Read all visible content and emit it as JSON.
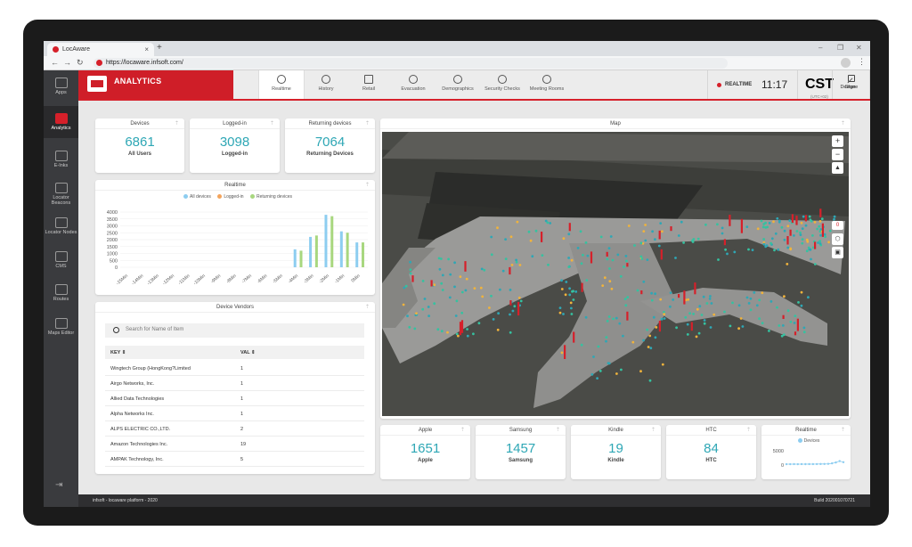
{
  "browser": {
    "tab_title": "LocAware",
    "url": "https://locaware.infsoft.com/"
  },
  "sidebar": {
    "items": [
      {
        "label": "Apps"
      },
      {
        "label": "Analytics"
      },
      {
        "label": "E-Inks"
      },
      {
        "label": "Locator Beacons"
      },
      {
        "label": "Locator Nodes"
      },
      {
        "label": "CMS"
      },
      {
        "label": "Routes"
      },
      {
        "label": "Maps Editor"
      }
    ]
  },
  "header": {
    "brand": "ANALYTICS",
    "tabs": [
      {
        "label": "Realtime"
      },
      {
        "label": "History"
      },
      {
        "label": "Retail"
      },
      {
        "label": "Evacuation"
      },
      {
        "label": "Demographics"
      },
      {
        "label": "Security Checks"
      },
      {
        "label": "Meeting Rooms"
      }
    ],
    "realtime_label": "REALTIME",
    "time": "11:17",
    "timezone": "CST",
    "timezone_offset": "(UTC+02)",
    "design_label": "Design",
    "share_label": "Share"
  },
  "kpis": {
    "devices": {
      "title": "Devices",
      "value": "6861",
      "label": "All Users"
    },
    "logged_in": {
      "title": "Logged-in",
      "value": "3098",
      "label": "Logged-in"
    },
    "returning": {
      "title": "Returning devices",
      "value": "7064",
      "label": "Returning Devices"
    }
  },
  "realtime": {
    "title": "Realtime",
    "legend": [
      "All devices",
      "Logged-in",
      "Returning devices"
    ]
  },
  "vendors": {
    "title": "Device Vendors",
    "search_placeholder": "Search for Name of Item",
    "col_key": "KEY",
    "col_val": "VAL",
    "rows": [
      {
        "key": "Wingtech Group (HongKong?Limited",
        "val": "1"
      },
      {
        "key": "Airgo Networks, Inc.",
        "val": "1"
      },
      {
        "key": "Allied Data Technologies",
        "val": "1"
      },
      {
        "key": "Alpha Networks Inc.",
        "val": "1"
      },
      {
        "key": "ALPS ELECTRIC CO.,LTD.",
        "val": "2"
      },
      {
        "key": "Amazon Technologies Inc.",
        "val": "19"
      },
      {
        "key": "AMPAK Technology, Inc.",
        "val": "5"
      }
    ]
  },
  "map": {
    "title": "Map"
  },
  "brands": {
    "apple": {
      "title": "Apple",
      "value": "1651",
      "label": "Apple"
    },
    "samsung": {
      "title": "Samsung",
      "value": "1457",
      "label": "Samsung"
    },
    "kindle": {
      "title": "Kindle",
      "value": "19",
      "label": "Kindle"
    },
    "htc": {
      "title": "HTC",
      "value": "84",
      "label": "HTC"
    }
  },
  "mini_realtime": {
    "title": "Realtime",
    "legend": "Devices",
    "ytick": "5000",
    "ytick0": "0"
  },
  "footer": {
    "left": "infsoft - locaware platform - 2020",
    "right": "Build 202001070721"
  },
  "colors": {
    "accent": "#d6202a",
    "kpi": "#2ea7b5",
    "all_devices": "#8dcdf0",
    "logged_in": "#f3a45c",
    "returning": "#a8d77f"
  },
  "chart_data": [
    {
      "type": "bar",
      "title": "Realtime",
      "categories": [
        "-15Min",
        "-14Min",
        "-13Min",
        "-12Min",
        "-11Min",
        "-10Min",
        "-9Min",
        "-8Min",
        "-7Min",
        "-6Min",
        "-5Min",
        "-4Min",
        "-3Min",
        "-2Min",
        "-1Min",
        "0Min"
      ],
      "x_tick_labels": [
        "-15Min",
        "-14Min",
        "-13Min",
        "-12Min",
        "-11Min",
        "-10Min",
        "-9Min",
        "-8Min",
        "-7Min",
        "-6Min",
        "-5Min",
        "-4Min",
        "-3Min",
        "-2Min",
        "-1Min",
        "0Min"
      ],
      "series": [
        {
          "name": "All devices",
          "values": [
            0,
            0,
            0,
            0,
            0,
            0,
            0,
            0,
            0,
            0,
            0,
            1300,
            2200,
            3800,
            2600,
            1800
          ]
        },
        {
          "name": "Logged-in",
          "values": [
            0,
            0,
            0,
            0,
            0,
            0,
            0,
            0,
            0,
            0,
            0,
            0,
            0,
            0,
            0,
            0
          ]
        },
        {
          "name": "Returning devices",
          "values": [
            0,
            0,
            0,
            0,
            0,
            0,
            0,
            0,
            0,
            0,
            0,
            1200,
            2300,
            3700,
            2500,
            1800
          ]
        }
      ],
      "yticks": [
        "0",
        "500",
        "1000",
        "1500",
        "2000",
        "2500",
        "3000",
        "3500",
        "4000"
      ],
      "ylim": [
        0,
        4000
      ],
      "legend": "top"
    },
    {
      "type": "line",
      "title": "Realtime",
      "series": [
        {
          "name": "Devices",
          "values": [
            300,
            300,
            320,
            300,
            320,
            310,
            330,
            320,
            340,
            360,
            380,
            420,
            600,
            900,
            1400,
            1000
          ]
        }
      ],
      "yticks": [
        "0",
        "5000"
      ],
      "ylim": [
        0,
        5000
      ]
    }
  ]
}
